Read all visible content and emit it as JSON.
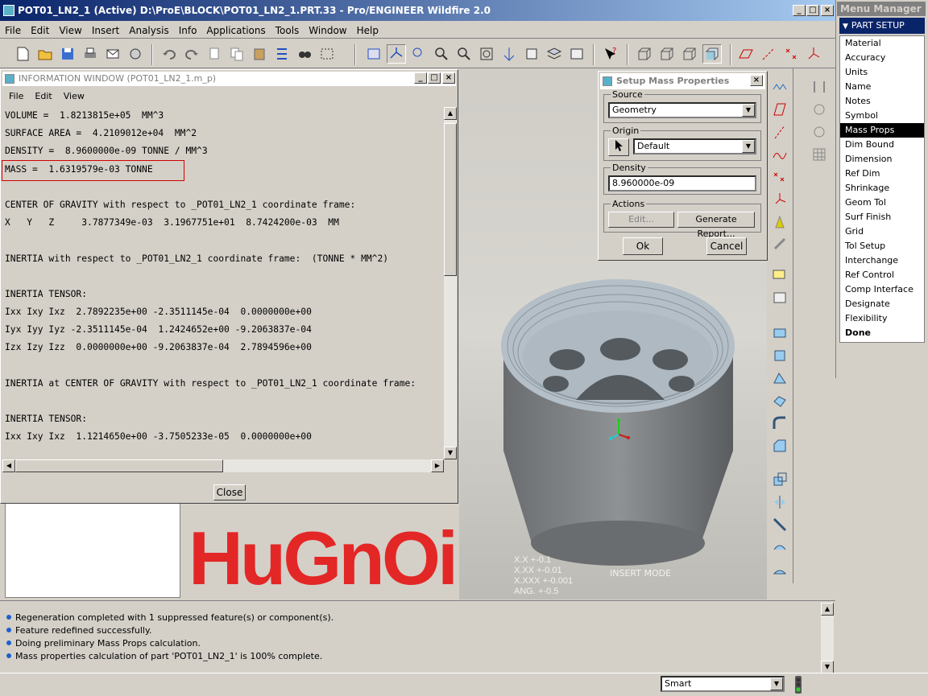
{
  "window": {
    "title": "POT01_LN2_1 (Active) D:\\ProE\\BLOCK\\POT01_LN2_1.PRT.33 - Pro/ENGINEER Wildfire 2.0"
  },
  "menubar": [
    "File",
    "Edit",
    "View",
    "Insert",
    "Analysis",
    "Info",
    "Applications",
    "Tools",
    "Window",
    "Help"
  ],
  "info_window": {
    "title": "INFORMATION WINDOW (POT01_LN2_1.m_p)",
    "menu": [
      "File",
      "Edit",
      "View"
    ],
    "lines": [
      "VOLUME =  1.8213815e+05  MM^3",
      "SURFACE AREA =  4.2109012e+04  MM^2",
      "DENSITY =  8.9600000e-09 TONNE / MM^3",
      "MASS =  1.6319579e-03 TONNE",
      "",
      "CENTER OF GRAVITY with respect to _POT01_LN2_1 coordinate frame:",
      "X   Y   Z     3.7877349e-03  3.1967751e+01  8.7424200e-03  MM",
      "",
      "INERTIA with respect to _POT01_LN2_1 coordinate frame:  (TONNE * MM^2)",
      "",
      "INERTIA TENSOR:",
      "Ixx Ixy Ixz  2.7892235e+00 -2.3511145e-04  0.0000000e+00",
      "Iyx Iyy Iyz -2.3511145e-04  1.2424652e+00 -9.2063837e-04",
      "Izx Izy Izz  0.0000000e+00 -9.2063837e-04  2.7894596e+00",
      "",
      "INERTIA at CENTER OF GRAVITY with respect to _POT01_LN2_1 coordinate frame:",
      "",
      "INERTIA TENSOR:",
      "Ixx Ixy Ixz  1.1214650e+00 -3.7505233e-05  0.0000000e+00"
    ],
    "close_label": "Close"
  },
  "mass_dialog": {
    "title": "Setup Mass Properties",
    "source_label": "Source",
    "source_value": "Geometry",
    "origin_label": "Origin",
    "origin_value": "Default",
    "density_label": "Density",
    "density_value": "8.960000e-09",
    "actions_label": "Actions",
    "edit_label": "Edit...",
    "report_label": "Generate Report...",
    "ok_label": "Ok",
    "cancel_label": "Cancel"
  },
  "menu_manager": {
    "title": "Menu Manager",
    "header": "PART SETUP",
    "items": [
      "Material",
      "Accuracy",
      "Units",
      "Name",
      "Notes",
      "Symbol",
      "Mass Props",
      "Dim Bound",
      "Dimension",
      "Ref Dim",
      "Shrinkage",
      "Geom Tol",
      "Surf Finish",
      "Grid",
      "Tol Setup",
      "Interchange",
      "Ref Control",
      "Comp Interface",
      "Designate",
      "Flexibility",
      "Done"
    ],
    "selected": "Mass Props"
  },
  "viewport": {
    "watermark": "HuGnOi",
    "tolerances": [
      "X.X    +-0.1",
      "X.XX   +-0.01",
      "X.XXX  +-0.001",
      "ANG.   +-0.5"
    ],
    "mode": "INSERT MODE"
  },
  "messages": [
    "Regeneration completed with 1 suppressed feature(s) or component(s).",
    "Feature redefined successfully.",
    "Doing preliminary Mass Props calculation.",
    "Mass properties calculation of part 'POT01_LN2_1' is 100% complete."
  ],
  "status": {
    "filter_value": "Smart"
  },
  "colors": {
    "title_blue": "#0a246a",
    "highlight_red": "#d00000",
    "model_gray": "#8a8d90"
  }
}
